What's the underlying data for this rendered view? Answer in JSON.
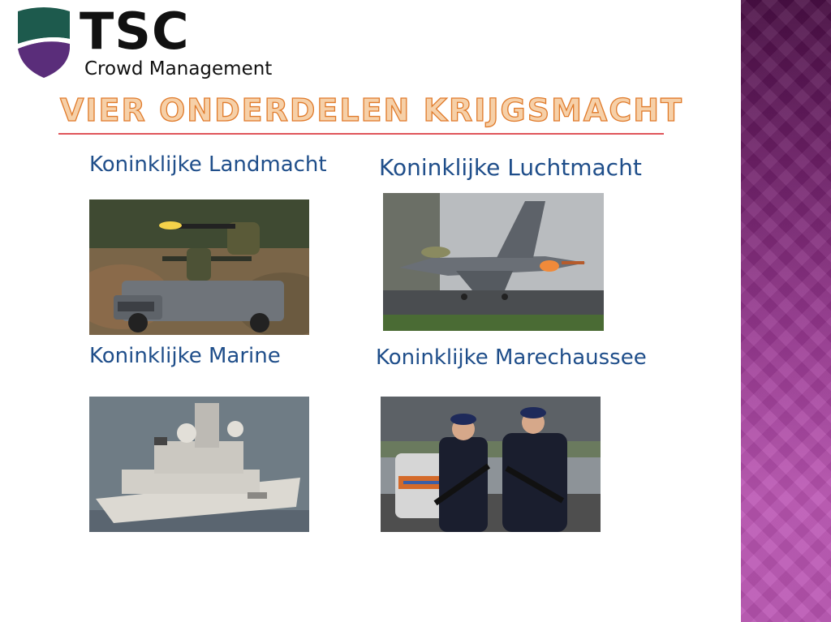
{
  "logo": {
    "brand": "TSC",
    "tagline": "Crowd Management",
    "colors": {
      "top": "#1d5a4d",
      "bottom": "#5a2d7a"
    }
  },
  "slide": {
    "title": "VIER ONDERDELEN KRIJGSMACHT",
    "accent_color": "#1f4e8a",
    "sidebar_color": "#8a2f84"
  },
  "sections": {
    "army": {
      "caption": "Koninklijke Landmacht",
      "image_icon": "army-vehicle-photo"
    },
    "air": {
      "caption": "Koninklijke Luchtmacht",
      "image_icon": "fighter-jet-photo"
    },
    "navy": {
      "caption": "Koninklijke Marine",
      "image_icon": "frigate-photo"
    },
    "marechaussee": {
      "caption": "Koninklijke Marechaussee",
      "image_icon": "military-police-photo"
    }
  }
}
